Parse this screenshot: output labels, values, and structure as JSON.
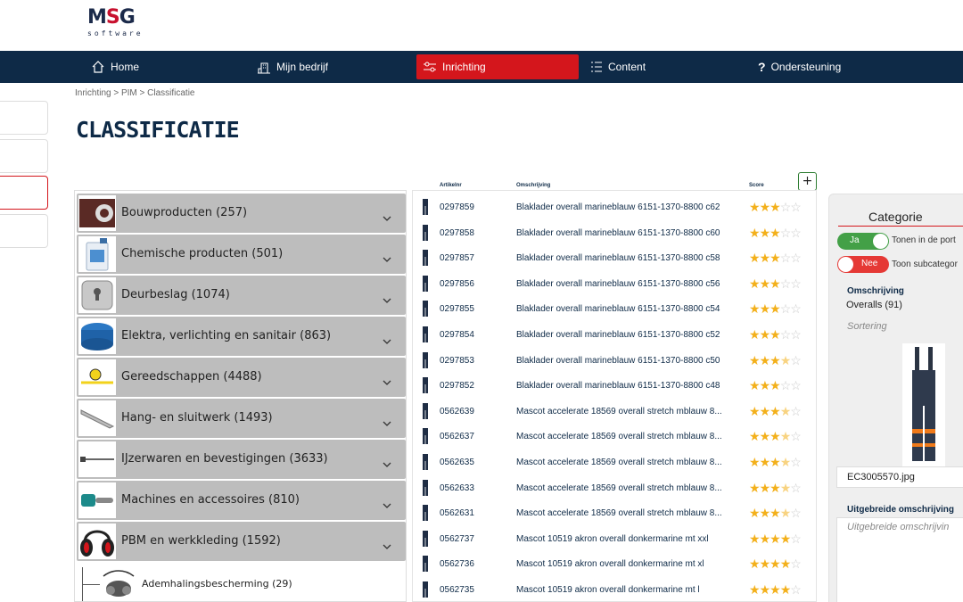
{
  "brand": {
    "logo_main_a": "M",
    "logo_main_s": "S",
    "logo_main_b": "G",
    "logo_sub": "software"
  },
  "nav": {
    "items": [
      {
        "label": "Home",
        "icon": "home-icon"
      },
      {
        "label": "Mijn bedrijf",
        "icon": "building-icon"
      },
      {
        "label": "Inrichting",
        "icon": "settings-sliders-icon",
        "active": true
      },
      {
        "label": "Content",
        "icon": "list-icon"
      },
      {
        "label": "Ondersteuning",
        "icon": "question-icon"
      }
    ]
  },
  "breadcrumb": "Inrichting > PIM > Classificatie",
  "page_title": "CLASSIFICATIE",
  "categories": [
    {
      "label": "Bouwproducten (257)",
      "icon": "bricks-image"
    },
    {
      "label": "Chemische producten (501)",
      "icon": "canister-image"
    },
    {
      "label": "Deurbeslag (1074)",
      "icon": "door-plate-image"
    },
    {
      "label": "Elektra, verlichting en sanitair (863)",
      "icon": "junction-box-image"
    },
    {
      "label": "Gereedschappen (4488)",
      "icon": "tape-measure-image"
    },
    {
      "label": "Hang- en sluitwerk (1493)",
      "icon": "hinge-image"
    },
    {
      "label": "IJzerwaren en bevestigingen (3633)",
      "icon": "screw-image"
    },
    {
      "label": "Machines en accessoires (810)",
      "icon": "chainsaw-image"
    },
    {
      "label": "PBM en werkkleding (1592)",
      "icon": "ear-muffs-image"
    }
  ],
  "subcategory": {
    "label": "Ademhalingsbescherming (29)",
    "icon": "respirator-image"
  },
  "articles": {
    "headers": {
      "nr": "Artikelnr",
      "desc": "Omschrijving",
      "score": "Score"
    },
    "add_label": "+",
    "rows": [
      {
        "nr": "0297859",
        "desc": "Blaklader overall marineblauw 6151-1370-8800 c62",
        "score": 3
      },
      {
        "nr": "0297858",
        "desc": "Blaklader overall marineblauw 6151-1370-8800 c60",
        "score": 3
      },
      {
        "nr": "0297857",
        "desc": "Blaklader overall marineblauw 6151-1370-8800 c58",
        "score": 3
      },
      {
        "nr": "0297856",
        "desc": "Blaklader overall marineblauw 6151-1370-8800 c56",
        "score": 3
      },
      {
        "nr": "0297855",
        "desc": "Blaklader overall marineblauw 6151-1370-8800 c54",
        "score": 3
      },
      {
        "nr": "0297854",
        "desc": "Blaklader overall marineblauw 6151-1370-8800 c52",
        "score": 3
      },
      {
        "nr": "0297853",
        "desc": "Blaklader overall marineblauw 6151-1370-8800 c50",
        "score": 3.5
      },
      {
        "nr": "0297852",
        "desc": "Blaklader overall marineblauw 6151-1370-8800 c48",
        "score": 3
      },
      {
        "nr": "0562639",
        "desc": "Mascot accelerate 18569 overall stretch mblauw 8...",
        "score": 3.5
      },
      {
        "nr": "0562637",
        "desc": "Mascot accelerate 18569 overall stretch mblauw 8...",
        "score": 3.5
      },
      {
        "nr": "0562635",
        "desc": "Mascot accelerate 18569 overall stretch mblauw 8...",
        "score": 3.5
      },
      {
        "nr": "0562633",
        "desc": "Mascot accelerate 18569 overall stretch mblauw 8...",
        "score": 3.5
      },
      {
        "nr": "0562631",
        "desc": "Mascot accelerate 18569 overall stretch mblauw 8...",
        "score": 3.5
      },
      {
        "nr": "0562737",
        "desc": "Mascot 10519 akron overall donkermarine mt xxl",
        "score": 4
      },
      {
        "nr": "0562736",
        "desc": "Mascot 10519 akron overall donkermarine mt xl",
        "score": 4
      },
      {
        "nr": "0562735",
        "desc": "Mascot 10519 akron overall donkermarine mt l",
        "score": 4
      }
    ]
  },
  "category_panel": {
    "title": "Categorie",
    "toggle_show": {
      "state": "Ja",
      "text": "Tonen in de port"
    },
    "toggle_sub": {
      "state": "Nee",
      "text": "Toon subcategor"
    },
    "desc_label": "Omschrijving",
    "desc_value": "Overalls (91)",
    "sort_placeholder": "Sortering",
    "image_file": "EC3005570.jpg",
    "ext_desc_label": "Uitgebreide omschrijving",
    "ext_desc_placeholder": "Uitgebreide omschrijvin"
  },
  "colors": {
    "navy": "#0e2a47",
    "accent_red": "#d4161c",
    "star": "#f3b01b",
    "toggle_on": "#43a047",
    "toggle_off": "#e53935"
  }
}
